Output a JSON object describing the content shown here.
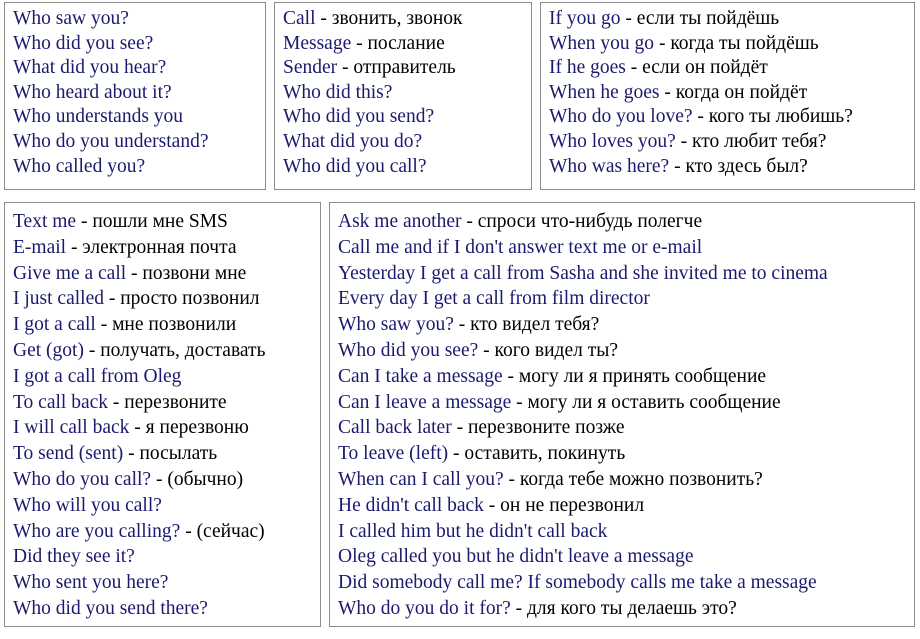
{
  "page": {
    "title": "English-Russian phrasebook reference sheet",
    "text_color_english": "#1a1a6e",
    "text_color_russian": "#000000",
    "border_color": "#8c8c8c",
    "background_color": "#ffffff"
  },
  "boxes": [
    {
      "id": "top-1",
      "lines": [
        {
          "en": "Who saw you?",
          "sep": "",
          "ru": ""
        },
        {
          "en": "Who did you see?",
          "sep": "",
          "ru": ""
        },
        {
          "en": "What did you hear?",
          "sep": "",
          "ru": ""
        },
        {
          "en": "Who heard about it?",
          "sep": "",
          "ru": ""
        },
        {
          "en": "Who understands you",
          "sep": "",
          "ru": ""
        },
        {
          "en": "Who do you understand?",
          "sep": "",
          "ru": ""
        },
        {
          "en": "Who called you?",
          "sep": "",
          "ru": ""
        }
      ]
    },
    {
      "id": "top-2",
      "lines": [
        {
          "en": "Call",
          "sep": " - ",
          "ru": "звонить, звонок"
        },
        {
          "en": "Message",
          "sep": " - ",
          "ru": "послание"
        },
        {
          "en": "Sender",
          "sep": " - ",
          "ru": "отправитель"
        },
        {
          "en": "Who did this?",
          "sep": "",
          "ru": ""
        },
        {
          "en": "Who did you send?",
          "sep": "",
          "ru": ""
        },
        {
          "en": "What did you do?",
          "sep": "",
          "ru": ""
        },
        {
          "en": "Who did you call?",
          "sep": "",
          "ru": ""
        }
      ]
    },
    {
      "id": "top-3",
      "lines": [
        {
          "en": "If you go",
          "sep": " - ",
          "ru": "если ты пойдёшь"
        },
        {
          "en": "When you go",
          "sep": " - ",
          "ru": "когда ты пойдёшь"
        },
        {
          "en": "If he goes",
          "sep": " - ",
          "ru": "если он пойдёт"
        },
        {
          "en": "When he goes",
          "sep": " - ",
          "ru": "когда он пойдёт"
        },
        {
          "en": "Who do you love?",
          "sep": " - ",
          "ru": "кого ты любишь?"
        },
        {
          "en": "Who loves you?",
          "sep": " - ",
          "ru": "кто любит тебя?"
        },
        {
          "en": "Who was here?",
          "sep": " - ",
          "ru": "кто здесь был?"
        }
      ]
    },
    {
      "id": "bot-1",
      "lines": [
        {
          "en": "Text me",
          "sep": " - ",
          "ru": "пошли мне SMS"
        },
        {
          "en": "E-mail",
          "sep": " - ",
          "ru": "электронная почта"
        },
        {
          "en": "Give me a call",
          "sep": " - ",
          "ru": "позвони мне"
        },
        {
          "en": "I just called",
          "sep": " - ",
          "ru": "просто позвонил"
        },
        {
          "en": "I got a call",
          "sep": " - ",
          "ru": "мне позвонили"
        },
        {
          "en": "Get (got)",
          "sep": " - ",
          "ru": "получать, доставать"
        },
        {
          "en": "I got a call from Oleg",
          "sep": "",
          "ru": ""
        },
        {
          "en": "To call back",
          "sep": " - ",
          "ru": "перезвоните"
        },
        {
          "en": "I will call back",
          "sep": " - ",
          "ru": "я перезвоню"
        },
        {
          "en": "To send (sent)",
          "sep": " - ",
          "ru": "посылать"
        },
        {
          "en": "Who do you call?",
          "sep": " - ",
          "ru": "(обычно)"
        },
        {
          "en": "Who will you call?",
          "sep": "",
          "ru": ""
        },
        {
          "en": "Who are you calling?",
          "sep": " - ",
          "ru": "(сейчас)"
        },
        {
          "en": "Did they see it?",
          "sep": "",
          "ru": ""
        },
        {
          "en": "Who sent you here?",
          "sep": "",
          "ru": ""
        },
        {
          "en": "Who did you send there?",
          "sep": "",
          "ru": ""
        }
      ]
    },
    {
      "id": "bot-2",
      "lines": [
        {
          "en": "Ask me another",
          "sep": " - ",
          "ru": "спроси что-нибудь полегче"
        },
        {
          "en": "Call me and if I don't answer text me or e-mail",
          "sep": "",
          "ru": ""
        },
        {
          "en": "Yesterday I get a call from Sasha and she invited me to cinema",
          "sep": "",
          "ru": ""
        },
        {
          "en": "Every day I get a call from film director",
          "sep": "",
          "ru": ""
        },
        {
          "en": "Who saw you?",
          "sep": " - ",
          "ru": "кто видел тебя?"
        },
        {
          "en": "Who did you see?",
          "sep": " - ",
          "ru": "кого видел ты?"
        },
        {
          "en": "Can I take a message",
          "sep": " - ",
          "ru": "могу ли я принять сообщение"
        },
        {
          "en": "Can I leave a message",
          "sep": " - ",
          "ru": "могу ли я оставить сообщение"
        },
        {
          "en": "Call back later",
          "sep": " - ",
          "ru": "перезвоните позже"
        },
        {
          "en": "To leave (left)",
          "sep": " - ",
          "ru": "оставить, покинуть"
        },
        {
          "en": "When can I call you?",
          "sep": " - ",
          "ru": "когда тебе можно позвонить?"
        },
        {
          "en": "He didn't call back",
          "sep": " - ",
          "ru": "он не перезвонил"
        },
        {
          "en": "I called him but he didn't call back",
          "sep": "",
          "ru": ""
        },
        {
          "en": "Oleg called you but he didn't leave a message",
          "sep": "",
          "ru": ""
        },
        {
          "en": "Did somebody call me? If somebody calls me take a message",
          "sep": "",
          "ru": ""
        },
        {
          "en": "Who do you do it for?",
          "sep": " - ",
          "ru": "для кого ты делаешь это?"
        }
      ]
    }
  ]
}
